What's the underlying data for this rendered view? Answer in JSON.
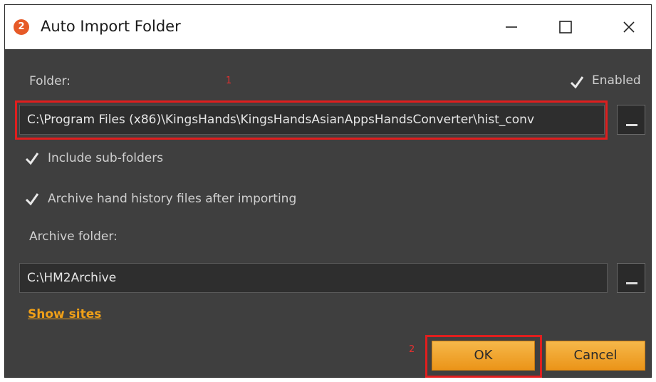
{
  "window": {
    "app_badge": "2",
    "title": "Auto Import Folder"
  },
  "form": {
    "folder_label": "Folder:",
    "folder_value": "C:\\Program Files (x86)\\KingsHands\\KingsHandsAsianAppsHandsConverter\\hist_conv",
    "enabled_label": "Enabled",
    "enabled_checked": true,
    "include_subfolders_label": "Include sub-folders",
    "include_subfolders_checked": true,
    "archive_after_import_label": "Archive hand history files after importing",
    "archive_after_import_checked": true,
    "archive_folder_label": "Archive folder:",
    "archive_folder_value": "C:\\HM2Archive",
    "show_sites_link": "Show sites"
  },
  "annotations": {
    "marker_1": "1",
    "marker_2": "2"
  },
  "buttons": {
    "ok_label": "OK",
    "cancel_label": "Cancel"
  },
  "colors": {
    "dialog_bg": "#3f3f3f",
    "accent_orange": "#eb9418",
    "link_orange": "#f0a018",
    "highlight_red": "#e01e1e"
  },
  "icons": {
    "title_icon": "app-logo-icon",
    "minimize": "minimize-icon",
    "maximize": "maximize-icon",
    "close": "close-icon",
    "check": "checkmark-icon",
    "browse": "ellipsis-browse-icon"
  }
}
